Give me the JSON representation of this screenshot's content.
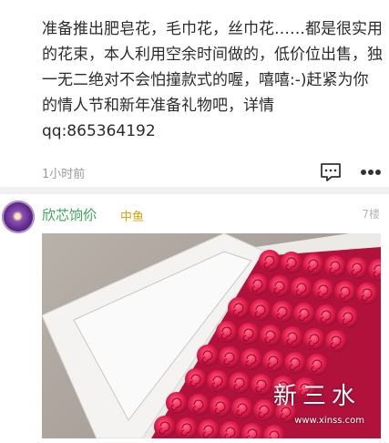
{
  "post": {
    "text": "准备推出肥皂花，毛巾花，丝巾花……都是很实用的花束，本人利用空余时间做的，低价位出售，独一无二绝对不会怕撞款式的喔，嘻嘻:-)赶紧为你的情人节和新年准备礼物吧，详情qq:865364192",
    "timestamp": "1小时前"
  },
  "reply": {
    "username": "欣芯饷伱",
    "level": "中鱼",
    "floor": "7楼"
  },
  "photo": {
    "watermark_text": "新三水",
    "watermark_url": "www.xinss.com"
  },
  "icons": [
    "comment-icon",
    "more-icon"
  ],
  "colors": {
    "username": "#3ea35a",
    "level_badge": "#e4a10c",
    "rose": "#e8204f"
  }
}
